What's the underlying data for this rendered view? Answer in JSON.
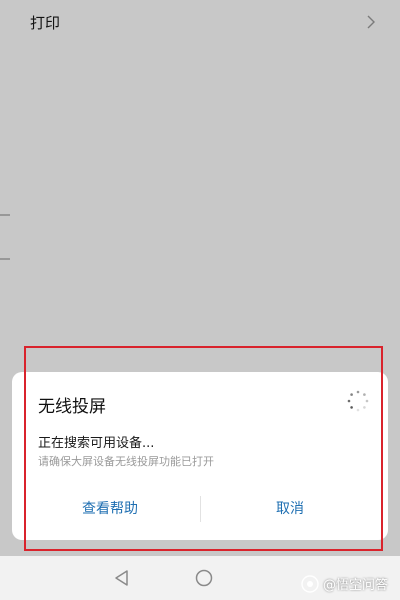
{
  "settings": {
    "print_label": "打印"
  },
  "dialog": {
    "title": "无线投屏",
    "status": "正在搜索可用设备...",
    "hint": "请确保大屏设备无线投屏功能已打开",
    "help_label": "查看帮助",
    "cancel_label": "取消"
  },
  "watermark": {
    "text": "@悟空问答"
  },
  "colors": {
    "accent": "#1f6fb2",
    "annotation": "#d9232c",
    "scrim": "rgba(0,0,0,0.20)"
  },
  "icons": {
    "print_row": "chevron-right-icon",
    "dialog": "loading-spinner-icon",
    "nav_back": "back-triangle-icon",
    "nav_home": "home-circle-icon",
    "watermark": "wukong-logo-icon"
  }
}
